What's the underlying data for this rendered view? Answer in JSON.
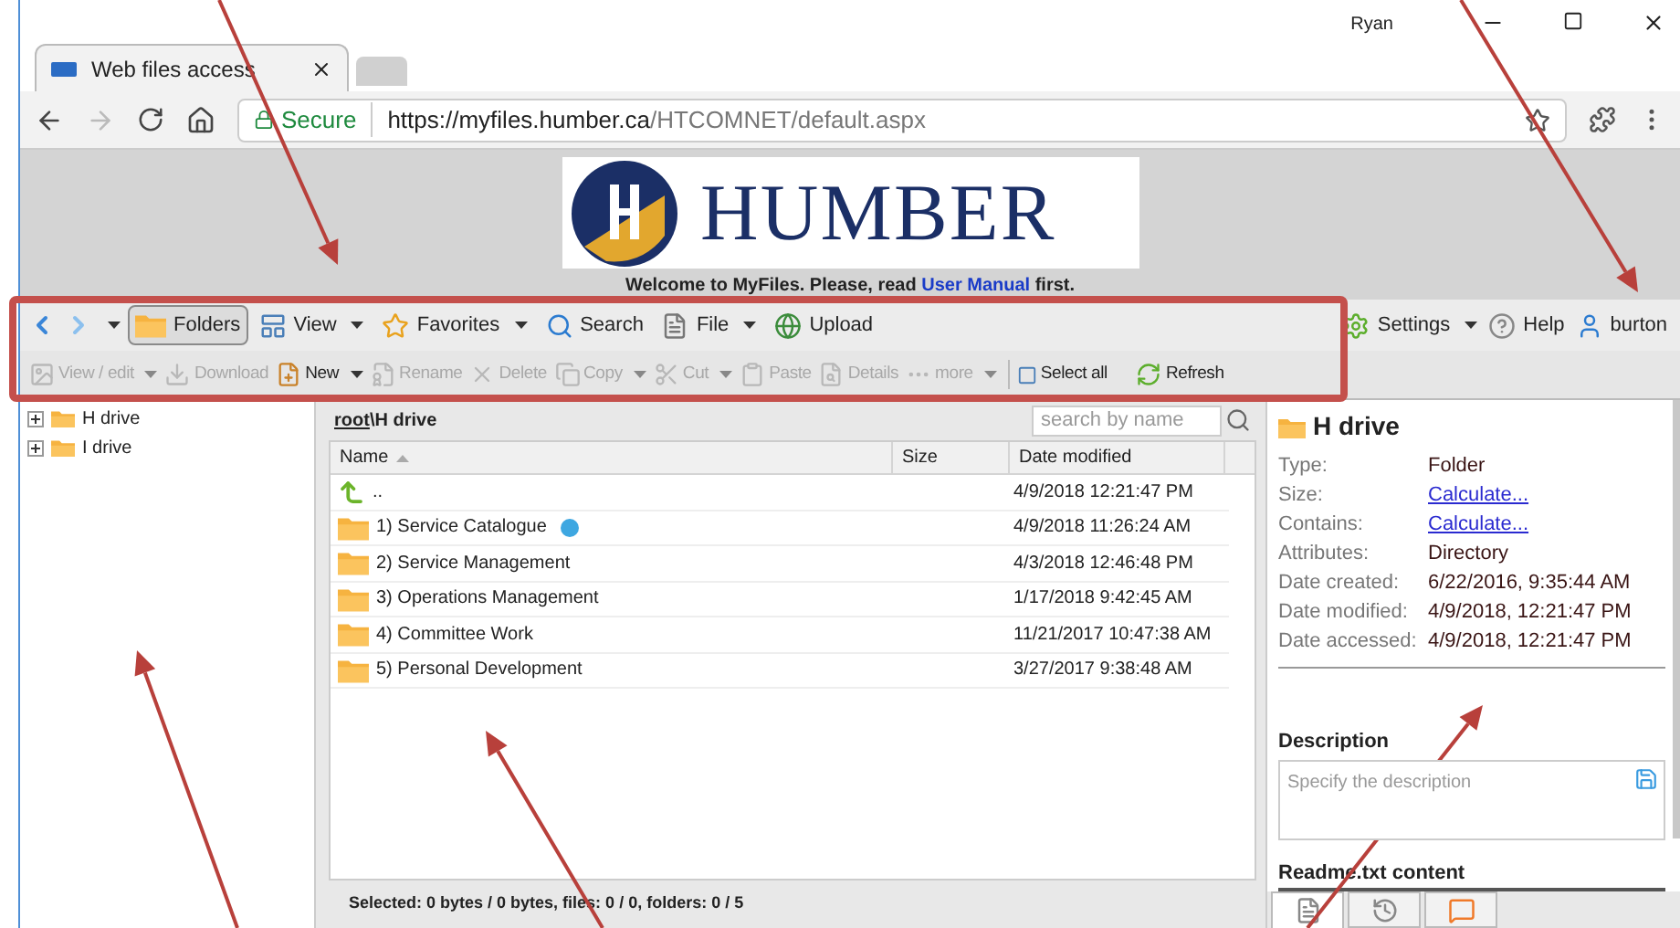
{
  "browser": {
    "user": "Ryan",
    "tab_title": "Web files access",
    "secure_label": "Secure",
    "url_host": "https://myfiles.humber.ca",
    "url_path": "/HTCOMNET/default.aspx"
  },
  "header": {
    "logo_text": "HUMBER",
    "welcome": "Welcome to MyFiles. Please, read ",
    "manual_link": "User Manual",
    "welcome_end": " first."
  },
  "toolbar": {
    "row1": [
      {
        "kind": "nav",
        "dropdown": true
      },
      {
        "kind": "button",
        "label": "Folders",
        "dropdown": false,
        "selected": true
      },
      {
        "kind": "button",
        "label": "View",
        "dropdown": true,
        "selected": false
      },
      {
        "kind": "button",
        "label": "Favorites",
        "dropdown": true,
        "selected": false
      },
      {
        "kind": "button",
        "label": "Search",
        "dropdown": false,
        "selected": false
      },
      {
        "kind": "button",
        "label": "File",
        "dropdown": true,
        "selected": false
      },
      {
        "kind": "button",
        "label": "Upload",
        "dropdown": false,
        "selected": false
      }
    ],
    "right": [
      {
        "label": "Settings",
        "dropdown": true
      },
      {
        "label": "Help",
        "dropdown": false
      },
      {
        "label": "burton",
        "dropdown": false
      }
    ],
    "row2": [
      {
        "label": "View / edit",
        "dropdown": true,
        "disabled": true
      },
      {
        "label": "Download",
        "dropdown": false,
        "disabled": true
      },
      {
        "label": "New",
        "dropdown": true,
        "disabled": false
      },
      {
        "label": "Rename",
        "dropdown": false,
        "disabled": true
      },
      {
        "label": "Delete",
        "dropdown": false,
        "disabled": true
      },
      {
        "label": "Copy",
        "dropdown": true,
        "disabled": true
      },
      {
        "label": "Cut",
        "dropdown": true,
        "disabled": true
      },
      {
        "label": "Paste",
        "dropdown": false,
        "disabled": true
      },
      {
        "label": "Details",
        "dropdown": false,
        "disabled": true
      },
      {
        "label": "more",
        "dropdown": true,
        "disabled": true
      },
      {
        "label": "Select all",
        "dropdown": false,
        "disabled": false
      },
      {
        "label": "Refresh",
        "dropdown": false,
        "disabled": false
      }
    ]
  },
  "tree": [
    {
      "label": "H drive",
      "expanded": false
    },
    {
      "label": "I drive",
      "expanded": false
    }
  ],
  "file_list": {
    "path_root": "root",
    "path_rest": "\\H drive",
    "search": {
      "placeholder": "search by name"
    },
    "columns": [
      {
        "label": "Name",
        "sorted": true
      },
      {
        "label": "Size",
        "sorted": false
      },
      {
        "label": "Date modified",
        "sorted": false
      }
    ],
    "rows": [
      {
        "kind": "up",
        "name": "..",
        "date": "4/9/2018 12:21:47 PM"
      },
      {
        "kind": "folder",
        "name": "1) Service Catalogue",
        "date": "4/9/2018 11:26:24 AM",
        "color": "#3ea7e1"
      },
      {
        "kind": "folder",
        "name": "2) Service Management",
        "date": "4/3/2018 12:46:48 PM"
      },
      {
        "kind": "folder",
        "name": "3) Operations Management",
        "date": "1/17/2018 9:42:45 AM"
      },
      {
        "kind": "folder",
        "name": "4) Committee Work",
        "date": "11/21/2017 10:47:38 AM"
      },
      {
        "kind": "folder",
        "name": "5) Personal Development",
        "date": "3/27/2017 9:38:48 AM"
      }
    ],
    "status": "Selected: 0 bytes / 0 bytes, files: 0 / 0, folders: 0 / 5"
  },
  "details": {
    "title": "H drive",
    "properties": [
      {
        "label": "Type:",
        "value": "Folder",
        "link": false
      },
      {
        "label": "Size:",
        "value": "Calculate...",
        "link": true
      },
      {
        "label": "Contains:",
        "value": "Calculate...",
        "link": true
      },
      {
        "label": "Attributes:",
        "value": "Directory",
        "link": false
      },
      {
        "label": "Date created:",
        "value": "6/22/2016, 9:35:44 AM",
        "link": false
      },
      {
        "label": "Date modified:",
        "value": "4/9/2018, 12:21:47 PM",
        "link": false
      },
      {
        "label": "Date accessed:",
        "value": "4/9/2018, 12:21:47 PM",
        "link": false
      }
    ],
    "description_heading": "Description",
    "description": {
      "placeholder": "Specify the description"
    },
    "readme_heading": "Readme.txt content",
    "tabs": [
      {
        "selected": true
      },
      {
        "selected": false
      },
      {
        "selected": false
      }
    ]
  }
}
